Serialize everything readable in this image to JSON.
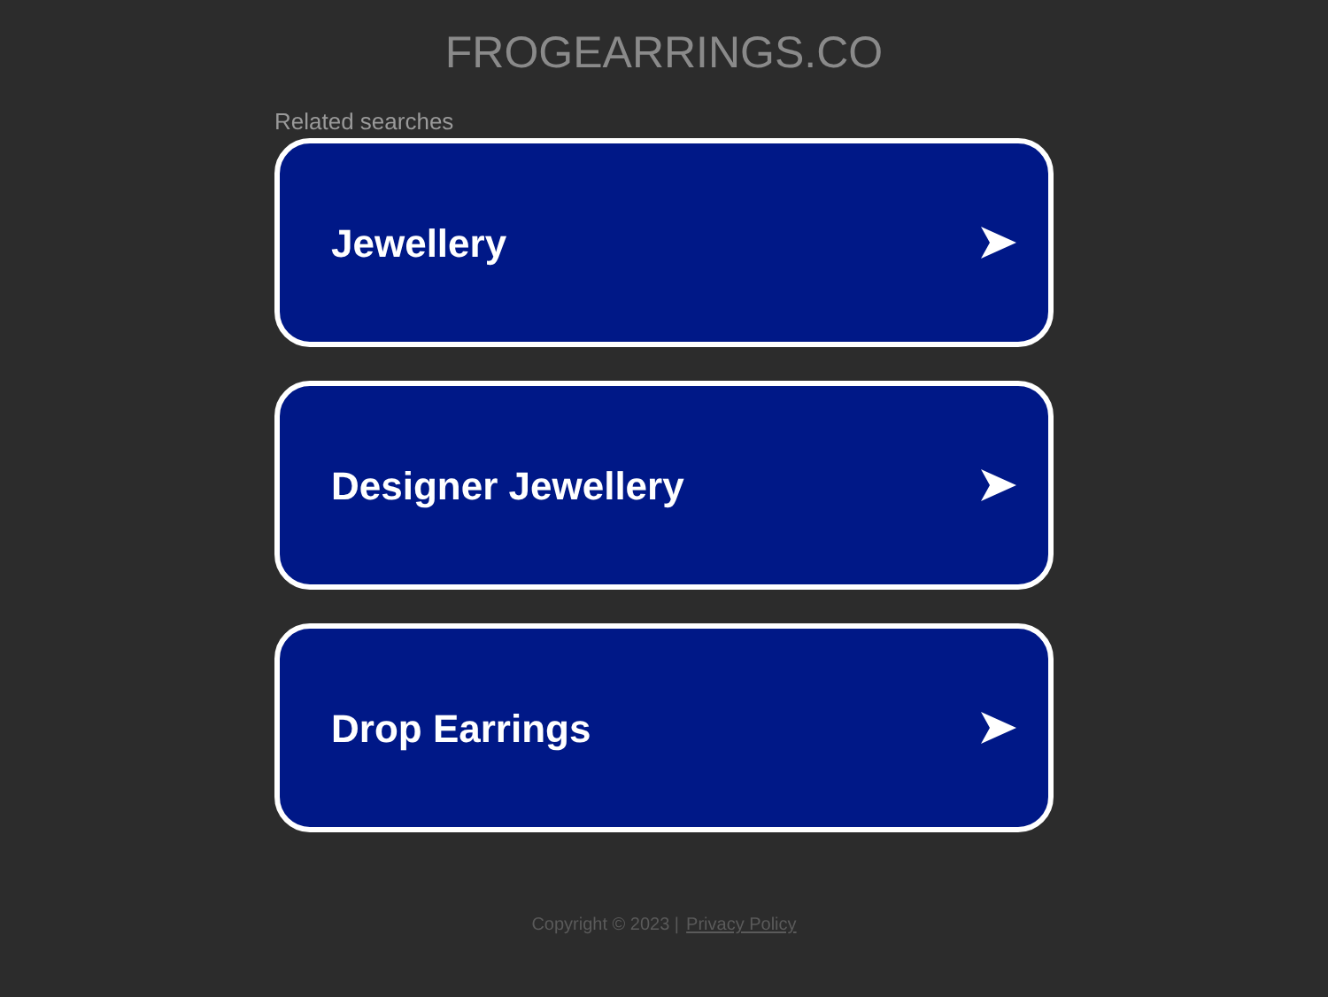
{
  "site_title": "FROGEARRINGS.CO",
  "related_searches": {
    "heading": "Related searches",
    "items": [
      {
        "label": "Jewellery"
      },
      {
        "label": "Designer Jewellery"
      },
      {
        "label": "Drop Earrings"
      }
    ]
  },
  "footer": {
    "copyright": "Copyright © 2023 |",
    "link": "Privacy Policy"
  }
}
